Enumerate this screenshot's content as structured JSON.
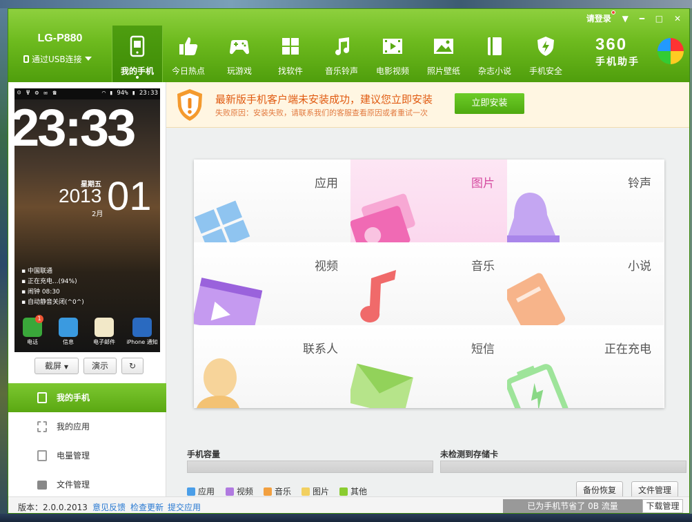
{
  "device": {
    "name": "LG-P880",
    "connection": "通过USB连接"
  },
  "window_controls": {
    "login": "请登录"
  },
  "nav": [
    {
      "label": "我的手机",
      "icon": "phone-icon",
      "active": true
    },
    {
      "label": "今日热点",
      "icon": "thumbs-up-icon"
    },
    {
      "label": "玩游戏",
      "icon": "gamepad-icon"
    },
    {
      "label": "找软件",
      "icon": "apps-grid-icon"
    },
    {
      "label": "音乐铃声",
      "icon": "music-note-icon"
    },
    {
      "label": "电影视频",
      "icon": "film-icon"
    },
    {
      "label": "照片壁纸",
      "icon": "picture-icon"
    },
    {
      "label": "杂志小说",
      "icon": "book-icon"
    },
    {
      "label": "手机安全",
      "icon": "shield-bolt-icon"
    }
  ],
  "logo": {
    "num": "360",
    "sub": "手机助手"
  },
  "phone_screen": {
    "battery": "94%",
    "status_time": "23:33",
    "clock": "23:33",
    "weekday": "星期五",
    "year": "2013",
    "day": "01",
    "month": "2月",
    "info": [
      "中国联通",
      "正在充电...(94%)",
      "闹钟 08:30",
      "自动静音关闭(^0^)"
    ],
    "apps": [
      {
        "label": "电话",
        "badge": "1"
      },
      {
        "label": "信息"
      },
      {
        "label": "电子邮件"
      },
      {
        "label": "iPhone 通知"
      }
    ]
  },
  "phone_controls": {
    "screenshot": "截屏",
    "demo": "演示"
  },
  "left_nav": [
    {
      "label": "我的手机",
      "active": true
    },
    {
      "label": "我的应用"
    },
    {
      "label": "电量管理"
    },
    {
      "label": "文件管理"
    }
  ],
  "notice": {
    "title": "最新版手机客户端未安装成功，建议您立即安装",
    "subtitle": "失败原因：安装失败，请联系我们的客服查看原因或者重试一次",
    "button": "立即安装"
  },
  "categories": [
    "应用",
    "图片",
    "铃声",
    "视频",
    "音乐",
    "小说",
    "联系人",
    "短信",
    "正在充电"
  ],
  "storage": {
    "phone_label": "手机容量",
    "sd_label": "未检测到存储卡"
  },
  "legend": [
    {
      "label": "应用",
      "color": "#4a9ee8"
    },
    {
      "label": "视频",
      "color": "#b07ae0"
    },
    {
      "label": "音乐",
      "color": "#f2a040"
    },
    {
      "label": "图片",
      "color": "#f2d060"
    },
    {
      "label": "其他",
      "color": "#8acc30"
    }
  ],
  "bottom_buttons": {
    "backup": "备份恢复",
    "files": "文件管理"
  },
  "footer": {
    "version": "版本：2.0.0.2013",
    "links": [
      "意见反馈",
      "检查更新",
      "提交应用"
    ],
    "saved": "已为手机节省了 0B 流量",
    "download": "下载管理"
  },
  "colors": {
    "brand_green": "#6dba1e",
    "notice_orange": "#e05a10",
    "highlight_pink": "#d54aa0"
  }
}
